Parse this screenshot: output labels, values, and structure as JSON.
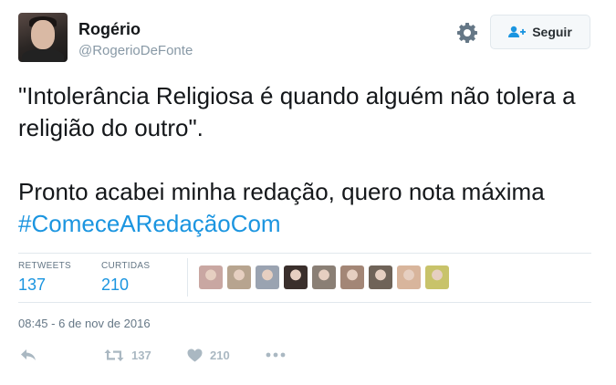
{
  "user": {
    "name": "Rogério",
    "handle": "@RogerioDeFonte"
  },
  "follow_button": {
    "label": "Seguir"
  },
  "tweet": {
    "paragraph1": "\"Intolerância Religiosa é quando alguém não tolera a religião do outro\".",
    "paragraph2_text": "Pronto acabei minha redação, quero nota máxima ",
    "hashtag": "#ComeceARedaçãoCom"
  },
  "stats": {
    "retweets_label": "RETWEETS",
    "retweets_value": "137",
    "likes_label": "CURTIDAS",
    "likes_value": "210"
  },
  "likers": [
    {
      "color": "#c9a7a2"
    },
    {
      "color": "#b7a48f"
    },
    {
      "color": "#9aa3b1"
    },
    {
      "color": "#3a2f2c"
    },
    {
      "color": "#8a7f75"
    },
    {
      "color": "#a38676"
    },
    {
      "color": "#6f6358"
    },
    {
      "color": "#d8b59c"
    },
    {
      "color": "#c8c36a"
    }
  ],
  "timestamp": "08:45 - 6 de nov de 2016",
  "actions": {
    "retweet_count": "137",
    "like_count": "210"
  },
  "colors": {
    "link": "#1b95e0",
    "muted": "#657786",
    "icon": "#aab8c2"
  }
}
